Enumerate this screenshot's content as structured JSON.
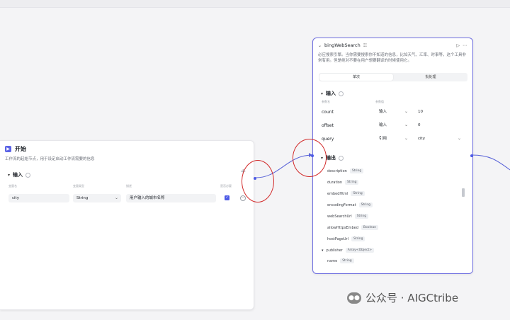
{
  "start_node": {
    "title": "开始",
    "icon": "flag-icon",
    "description": "工作流的起始节点，用于设定启动工作流需要的信息",
    "input_section": "输入",
    "col_var": "变量名",
    "col_type": "变量类型",
    "col_desc": "描述",
    "col_required": "是否必要",
    "row": {
      "name": "city",
      "type": "String",
      "desc": "用户输入的城市名称",
      "required": true
    },
    "add_symbol": "+"
  },
  "bing_node": {
    "title": "bingWebSearch",
    "badge": "☷",
    "description": "必应搜索引擎。当你需要搜索你不知道的信息，比如天气、汇率、时事等，这个工具非常有用。但是绝对不要在用户想要翻译的时候使用它。",
    "tabs": [
      "单次",
      "批处理"
    ],
    "input_section": "输入",
    "col_param": "参数名",
    "col_value": "参数值",
    "inputs": [
      {
        "name": "count",
        "mode": "输入",
        "value": "10"
      },
      {
        "name": "offset",
        "mode": "输入",
        "value": "0"
      },
      {
        "name": "query",
        "mode": "引用",
        "value": "city"
      }
    ],
    "output_section": "输出",
    "outputs": [
      {
        "name": "description",
        "type": "String"
      },
      {
        "name": "duration",
        "type": "String"
      },
      {
        "name": "embedHtml",
        "type": "String"
      },
      {
        "name": "encodingFormat",
        "type": "String"
      },
      {
        "name": "webSearchUrl",
        "type": "String"
      },
      {
        "name": "allowHttpsEmbed",
        "type": "Boolean"
      },
      {
        "name": "hostPageUrl",
        "type": "String"
      },
      {
        "name": "publisher",
        "type": "Array<Object>"
      },
      {
        "name": "name",
        "type": "String"
      }
    ]
  },
  "watermark": "公众号 · AIGCtribe",
  "colors": {
    "accent": "#4e5be6",
    "highlight": "#d22a2a",
    "node_border": "#6f6fe0"
  }
}
